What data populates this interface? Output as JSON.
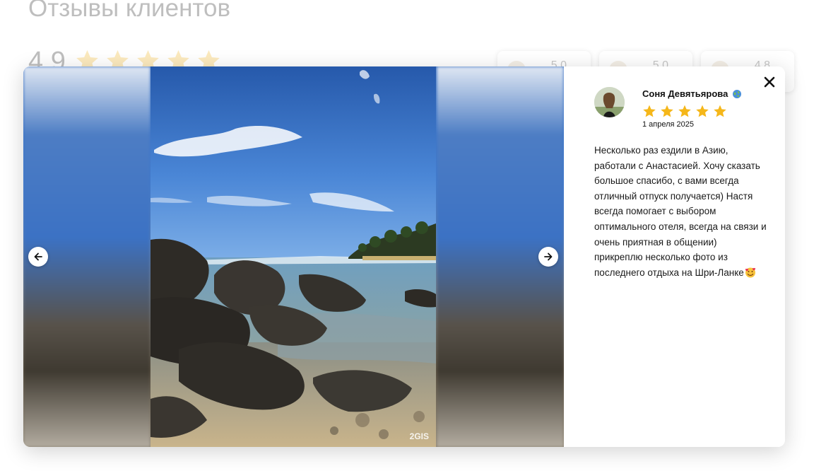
{
  "background": {
    "title": "Отзывы клиентов",
    "rating": "4.9",
    "star_count": 5,
    "cards": [
      {
        "score": "5.0"
      },
      {
        "score": "5.0"
      },
      {
        "score": "4.8"
      }
    ]
  },
  "gallery": {
    "watermark": "2GIS",
    "prev_icon": "arrow-left-icon",
    "next_icon": "arrow-right-icon"
  },
  "review": {
    "author": "Соня Девятьярова",
    "author_badge_icon": "globe-icon",
    "rating": 5,
    "date": "1 апреля 2025",
    "text": "Несколько раз ездили в Азию, работали с Анастасией. Хочу сказать большое спасибо, с вами всегда отличный отпуск получается) Настя всегда помогает с выбором оптимального отеля, всегда на связи и очень приятная в общении) прикреплю несколько фото из последнего отдыха на Шри-Ланке",
    "text_emoji_icon": "smiling-face-hearts-icon"
  },
  "colors": {
    "star": "#f5b71a",
    "text": "#1a1a1a"
  }
}
